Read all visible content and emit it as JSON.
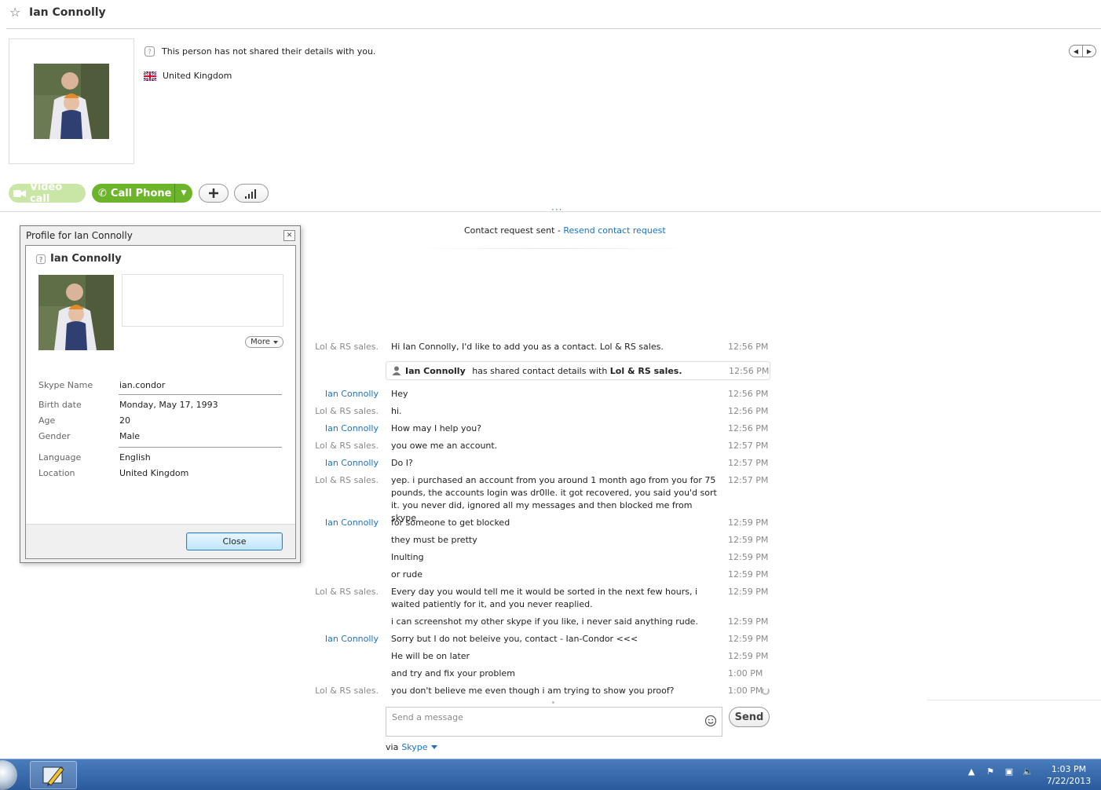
{
  "header": {
    "contact_name": "Ian Connolly"
  },
  "profile": {
    "not_shared_text": "This person has not shared their details with you.",
    "country": "United Kingdom"
  },
  "call_bar": {
    "video_call_label": "Video call",
    "call_phone_label": "Call Phone"
  },
  "chat": {
    "request_sent_text": "Contact request sent - ",
    "resend_link": "Resend contact request",
    "shared_contact": {
      "name": "Ian Connolly",
      "middle": " has shared contact details with ",
      "target": "Lol & RS sales.",
      "time": "12:56 PM"
    },
    "messages": [
      {
        "sender": "Lol & RS sales.",
        "text": "Hi Ian Connolly, I'd like to add you as a contact. Lol & RS sales.",
        "time": "12:56 PM"
      },
      {
        "sender": "Ian Connolly",
        "text": "Hey",
        "time": "12:56 PM"
      },
      {
        "sender": "Lol & RS sales.",
        "text": "hi.",
        "time": "12:56 PM"
      },
      {
        "sender": "Ian Connolly",
        "text": "How may I help you?",
        "time": "12:56 PM"
      },
      {
        "sender": "Lol & RS sales.",
        "text": "you owe me an account.",
        "time": "12:57 PM"
      },
      {
        "sender": "Ian Connolly",
        "text": "Do I?",
        "time": "12:57 PM"
      },
      {
        "sender": "Lol & RS sales.",
        "text": "yep. i purchased an account from you around 1 month ago from you for 75 pounds, the accounts login was dr0lle. it got recovered, you said you'd sort it. you never did, ignored all my messages and then blocked me from skype",
        "time": "12:57 PM"
      },
      {
        "sender": "Ian Connolly",
        "text": "for someone to get blocked",
        "time": "12:59 PM"
      },
      {
        "sender": "",
        "text": "they must be pretty",
        "time": "12:59 PM"
      },
      {
        "sender": "",
        "text": "Inulting",
        "time": "12:59 PM"
      },
      {
        "sender": "",
        "text": "or rude",
        "time": "12:59 PM"
      },
      {
        "sender": "Lol & RS sales.",
        "text": "Every day you would tell me it would be sorted in the next few hours, i waited patiently for it, and you never reaplied.",
        "time": "12:59 PM"
      },
      {
        "sender": "",
        "text": "i can screenshot my other skype if you like, i never said anything rude.",
        "time": "12:59 PM"
      },
      {
        "sender": "Ian Connolly",
        "text": "Sorry but I do not beleive you, contact - Ian-Condor <<<",
        "time": "12:59 PM"
      },
      {
        "sender": "",
        "text": "He will  be on later",
        "time": "12:59 PM"
      },
      {
        "sender": "",
        "text": "and try and fix your problem",
        "time": "1:00 PM"
      },
      {
        "sender": "Lol & RS sales.",
        "text": "you don't believe me even though i am trying to show you proof?",
        "time": "1:00 PM"
      }
    ],
    "input_placeholder": "Send a message",
    "send_label": "Send",
    "via_label": "via",
    "via_link": "Skype"
  },
  "dialog": {
    "title": "Profile for Ian Connolly",
    "name": "Ian Connolly",
    "more_label": "More",
    "fields": {
      "skype_name": {
        "label": "Skype Name",
        "value": "ian.condor"
      },
      "birth_date": {
        "label": "Birth date",
        "value": "Monday, May 17, 1993"
      },
      "age": {
        "label": "Age",
        "value": "20"
      },
      "gender": {
        "label": "Gender",
        "value": "Male"
      },
      "language": {
        "label": "Language",
        "value": "English"
      },
      "location": {
        "label": "Location",
        "value": "United Kingdom"
      }
    },
    "close_label": "Close"
  },
  "taskbar": {
    "time": "1:03 PM",
    "date": "7/22/2013"
  },
  "colors": {
    "link_blue": "#1b73c5",
    "call_green": "#6cb52a",
    "video_green_disabled": "#c9e6a6",
    "taskbar_blue": "#2a5a9c"
  }
}
